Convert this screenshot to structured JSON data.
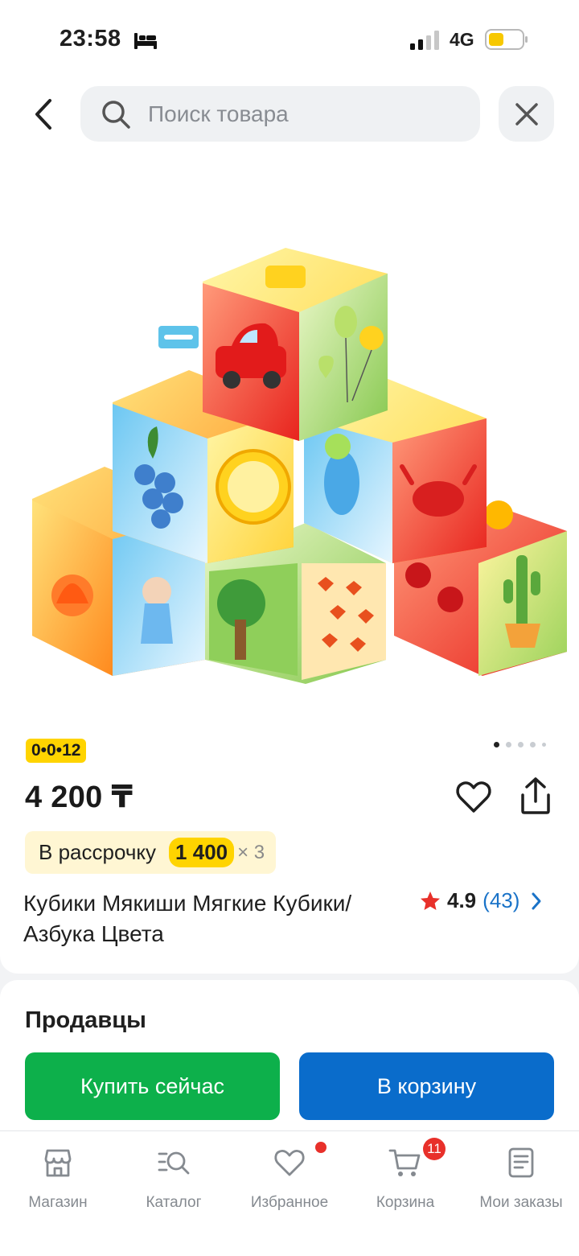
{
  "status_bar": {
    "time": "23:58",
    "network": "4G",
    "icons": [
      "bed-icon",
      "signal-icon",
      "battery-icon"
    ]
  },
  "header": {
    "search_placeholder": "Поиск товара",
    "icons": [
      "back-icon",
      "search-icon",
      "close-icon"
    ]
  },
  "product": {
    "promo_badge": "0•0•12",
    "price": "4 200 ₸",
    "installment_label": "В рассрочку",
    "installment_amount": "1 400",
    "installment_times": "× 3",
    "title": "Кубики Мякиши Мягкие Кубики/ Азбука Цвета",
    "rating": "4.9",
    "reviews": "(43)",
    "image_count": 5,
    "active_image": 1
  },
  "sellers": {
    "title": "Продавцы",
    "buy_now_label": "Купить сейчас",
    "add_to_cart_label": "В корзину"
  },
  "bottom_nav": {
    "items": [
      {
        "label": "Магазин",
        "icon": "store-icon"
      },
      {
        "label": "Каталог",
        "icon": "catalog-search-icon"
      },
      {
        "label": "Избранное",
        "icon": "heart-icon"
      },
      {
        "label": "Корзина",
        "icon": "cart-icon",
        "badge": "11"
      },
      {
        "label": "Мои заказы",
        "icon": "orders-icon"
      }
    ]
  },
  "colors": {
    "accent_blue": "#0a6ccb",
    "buy_green": "#0db04b",
    "promo_yellow": "#ffd400",
    "badge_red": "#e8302a",
    "link_blue": "#1a73c8"
  }
}
